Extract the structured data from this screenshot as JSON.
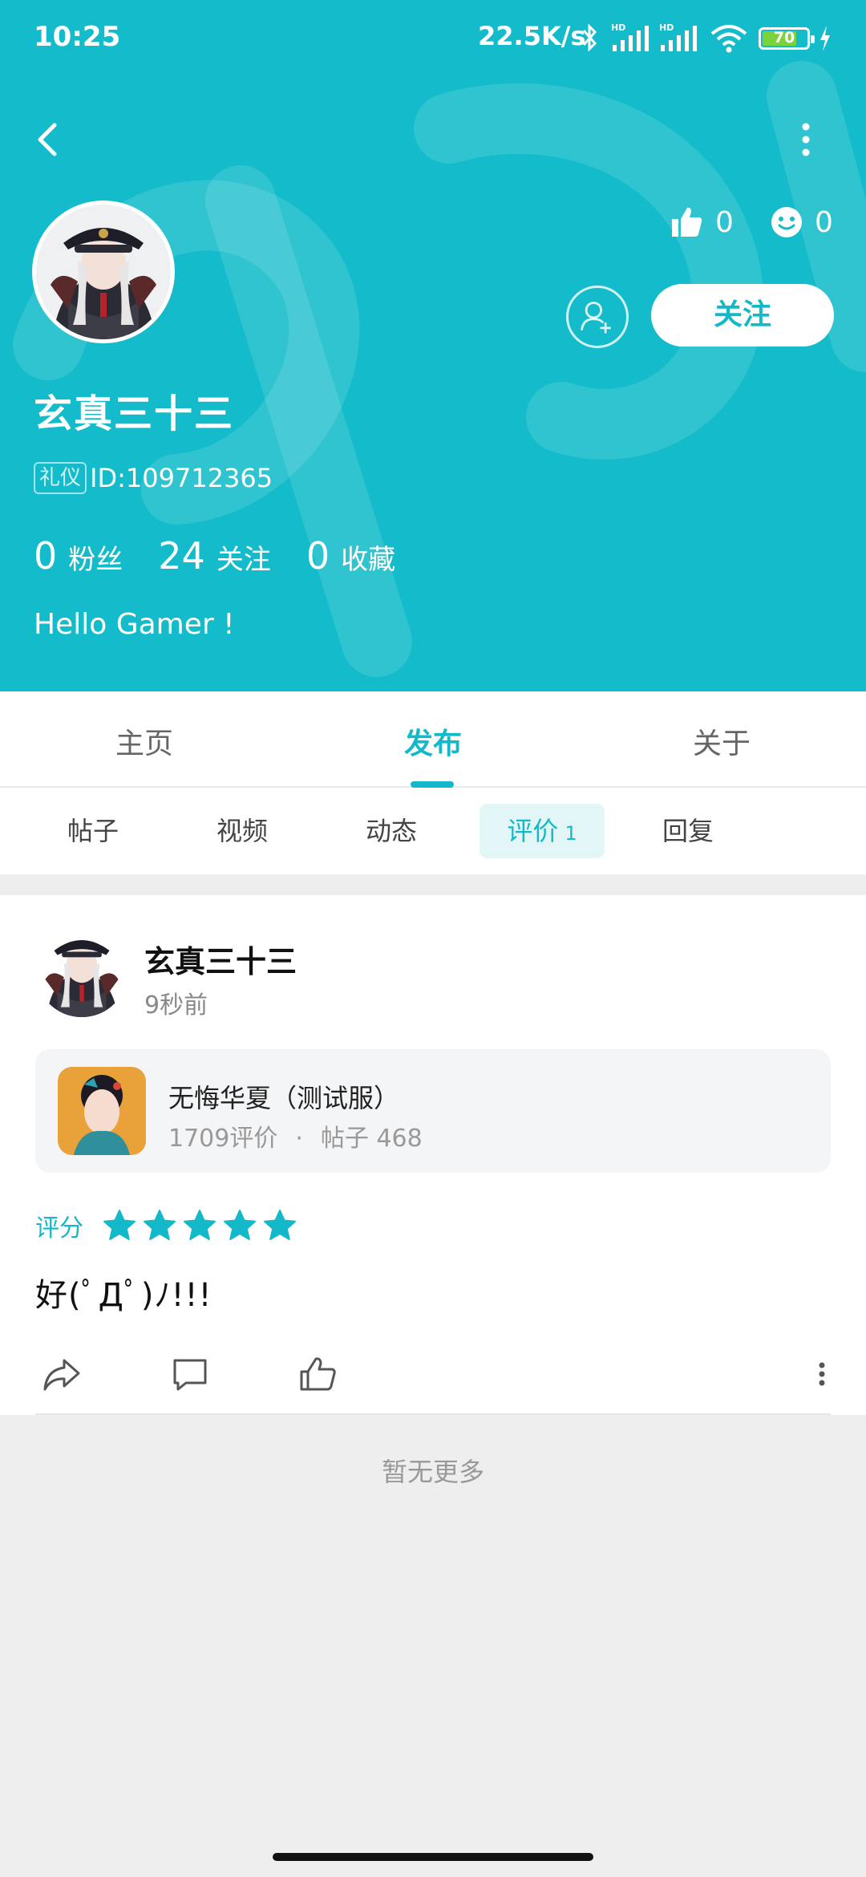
{
  "status_bar": {
    "time": "10:25",
    "network_speed": "22.5K/s",
    "battery": "70",
    "icons": [
      "bluetooth-icon",
      "signal-hd-icon",
      "signal-hd-icon",
      "wifi-icon",
      "battery-icon",
      "charging-icon"
    ]
  },
  "colors": {
    "brand": "#14bccb",
    "accent_text": "#14b9c9",
    "star": "#14b9c9"
  },
  "header": {
    "likes": "0",
    "smiles": "0",
    "follow_label": "关注",
    "username": "玄真三十三",
    "badge": "礼仪",
    "user_id": "ID:109712365",
    "fans_count": "0",
    "fans_label": "粉丝",
    "following_count": "24",
    "following_label": "关注",
    "favorites_count": "0",
    "favorites_label": "收藏",
    "bio": "Hello Gamer !"
  },
  "main_tabs": [
    {
      "label": "主页"
    },
    {
      "label": "发布"
    },
    {
      "label": "关于"
    }
  ],
  "active_main_tab": "发布",
  "sub_tabs": [
    {
      "label": "帖子"
    },
    {
      "label": "视频"
    },
    {
      "label": "动态"
    },
    {
      "label": "评价",
      "count": "1"
    },
    {
      "label": "回复"
    }
  ],
  "active_sub_tab": "评价",
  "review": {
    "author": "玄真三十三",
    "time": "9秒前",
    "game": {
      "title": "无悔华夏（测试服）",
      "reviews": "1709评价",
      "separator": "·",
      "posts": "帖子 468"
    },
    "rating_label": "评分",
    "rating_stars": 5,
    "rating_max": 5,
    "text": "好(ﾟДﾟ)ﾉ!!!"
  },
  "footer_text": "暂无更多"
}
